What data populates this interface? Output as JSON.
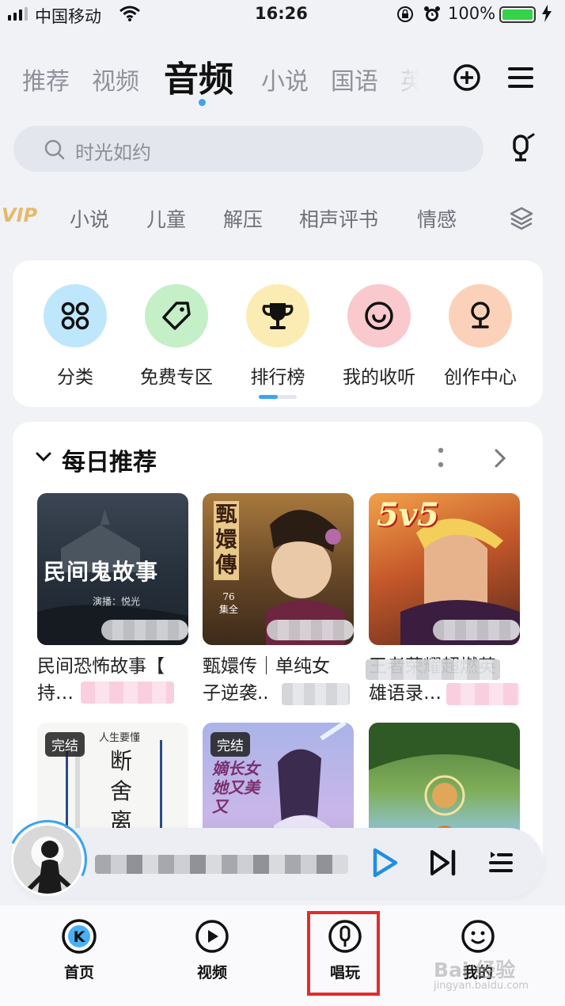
{
  "status_bar": {
    "carrier": "中国移动",
    "time": "16:26",
    "battery": "100%"
  },
  "top_tabs": [
    {
      "label": "推荐"
    },
    {
      "label": "视频"
    },
    {
      "label": "音频",
      "active": true
    },
    {
      "label": "小说"
    },
    {
      "label": "国语"
    },
    {
      "label": "英"
    }
  ],
  "search": {
    "placeholder": "时光如约"
  },
  "categories": {
    "vip": "VIP",
    "items": [
      "小说",
      "儿童",
      "解压",
      "相声评书",
      "情感"
    ]
  },
  "quick_entries": [
    {
      "label": "分类",
      "icon": "grid-icon",
      "color": "#bfe7fb"
    },
    {
      "label": "免费专区",
      "icon": "tag-icon",
      "color": "#c4efc7"
    },
    {
      "label": "排行榜",
      "icon": "trophy-icon",
      "color": "#fbecb4"
    },
    {
      "label": "我的收听",
      "icon": "smile-headphone-icon",
      "color": "#f9c9cd"
    },
    {
      "label": "创作中心",
      "icon": "microphone-icon",
      "color": "#fbd2b9"
    }
  ],
  "daily": {
    "title": "每日推荐",
    "books": [
      {
        "title_line1": "民间恐怖故事【",
        "title_line2": "持…",
        "cover_text": "民间鬼故事",
        "cover_sub": "演播：悦光"
      },
      {
        "title_line1": "甄嬛传｜单纯女",
        "title_line2": "子逆袭..",
        "cover_text": "甄嬛傳",
        "cover_sub": "76集全"
      },
      {
        "title_line1": "王者荣耀超燃英",
        "title_line2": "雄语录…",
        "cover_text": "5v5"
      },
      {
        "tag": "完结",
        "cover_text": "断舍离",
        "cover_sub": "人生要懂"
      },
      {
        "tag": "完结",
        "cover_text": "嫡长女 她又美又"
      },
      {}
    ]
  },
  "bottom_nav": [
    {
      "label": "首页",
      "icon": "k-logo-icon"
    },
    {
      "label": "视频",
      "icon": "play-circle-icon"
    },
    {
      "label": "唱玩",
      "icon": "mic-circle-icon",
      "highlighted": true
    },
    {
      "label": "我的",
      "icon": "smiley-icon"
    }
  ],
  "watermark": {
    "brand": "Bai 经验",
    "url": "jingyan.baidu.com"
  },
  "colors": {
    "accent": "#3aa4f0",
    "highlight_box": "#e62b2b"
  }
}
